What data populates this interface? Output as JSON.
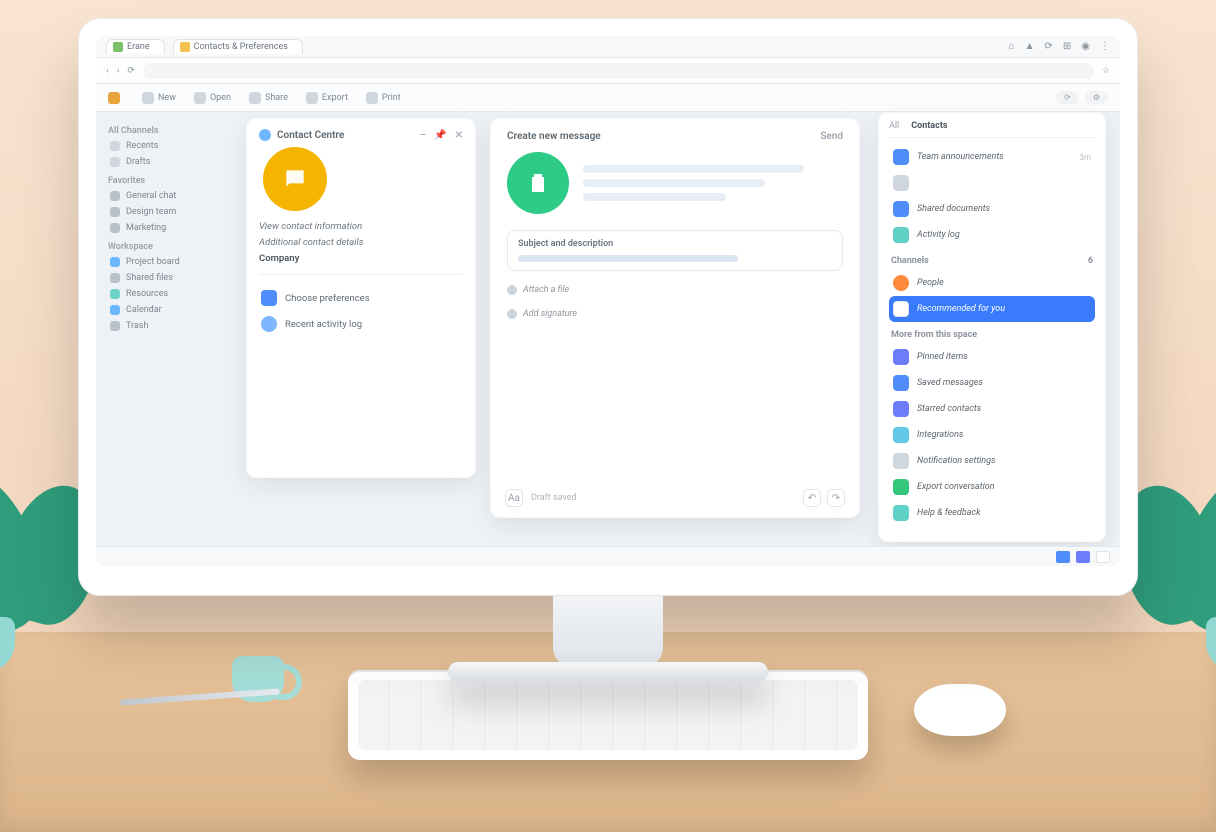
{
  "browser": {
    "tab1": {
      "favicon": "#7bbf6b",
      "label": "Erane"
    },
    "tab2": {
      "favicon": "#f2c14e",
      "label": "Contacts & Preferences"
    },
    "actions": [
      "home",
      "bell",
      "sync",
      "ext",
      "user",
      "menu"
    ],
    "url": "",
    "nav_icons": [
      "back",
      "forward",
      "reload"
    ]
  },
  "toolbar": {
    "items": [
      {
        "icon": "#e8a33b",
        "label": ""
      },
      {
        "icon": "#cfd6dd",
        "label": "New"
      },
      {
        "icon": "#cfd6dd",
        "label": "Open"
      },
      {
        "icon": "#cfd6dd",
        "label": "Share"
      },
      {
        "icon": "#cfd6dd",
        "label": "Export"
      },
      {
        "icon": "#cfd6dd",
        "label": "Print"
      }
    ],
    "right": [
      "refresh",
      "settings"
    ]
  },
  "leftnav": {
    "sections": [
      {
        "title": "All Channels",
        "items": [
          {
            "color": "#cfd6dd",
            "label": "Recents"
          },
          {
            "color": "#cfd6dd",
            "label": "Drafts"
          }
        ]
      },
      {
        "title": "Favorites",
        "items": [
          {
            "color": "#b9c2cb",
            "label": "General chat"
          },
          {
            "color": "#b9c2cb",
            "label": "Design team"
          },
          {
            "color": "#b9c2cb",
            "label": "Marketing"
          }
        ]
      },
      {
        "title": "Workspace",
        "items": [
          {
            "color": "#6fb7ff",
            "label": "Project board"
          },
          {
            "color": "#b9c2cb",
            "label": "Shared files"
          },
          {
            "color": "#6ed3c7",
            "label": "Resources"
          },
          {
            "color": "#6fb7ff",
            "label": "Calendar"
          }
        ]
      },
      {
        "title": "",
        "items": [
          {
            "color": "#b9c2cb",
            "label": "Trash"
          }
        ]
      }
    ]
  },
  "card_left": {
    "title": "Contact Centre",
    "actions": [
      "minimize",
      "pin",
      "close"
    ],
    "avatar_icon": "chat-bubble",
    "rows": [
      "View contact information",
      "Additional contact details",
      "Company"
    ],
    "links": [
      {
        "color": "blue",
        "label": "Choose preferences"
      },
      {
        "color": "lblue",
        "label": "Recent activity log"
      }
    ]
  },
  "card_center": {
    "title": "Create new message",
    "action": "Send",
    "hero_icon": "clipboard",
    "input_label": "Subject and description",
    "meta1": "Attach a file",
    "meta2": "Add signature",
    "footer_left": "Draft saved",
    "footer_hint": "Aa",
    "footer_icons": [
      "undo",
      "redo"
    ]
  },
  "card_right": {
    "tabs": [
      "All",
      "Contacts"
    ],
    "section1": {
      "items": [
        {
          "icon": "c-blue",
          "label": "Team announcements",
          "meta": "3m"
        },
        {
          "icon": "c-gray",
          "label": "",
          "meta": ""
        },
        {
          "icon": "c-blue",
          "label": "Shared documents",
          "meta": ""
        },
        {
          "icon": "c-teal",
          "label": "Activity log",
          "meta": ""
        }
      ]
    },
    "section2": {
      "title": "Channels",
      "meta": "6",
      "items": [
        {
          "icon": "c-orange round",
          "label": "People",
          "meta": ""
        },
        {
          "icon": "c-white",
          "label": "Recommended for you",
          "highlight": true
        }
      ]
    },
    "section3": {
      "title": "More from this space",
      "items": [
        {
          "icon": "c-indigo",
          "label": "Pinned items"
        },
        {
          "icon": "c-blue",
          "label": "Saved messages"
        },
        {
          "icon": "c-indigo",
          "label": "Starred contacts"
        },
        {
          "icon": "c-cyan",
          "label": "Integrations"
        },
        {
          "icon": "c-gray",
          "label": "Notification settings"
        },
        {
          "icon": "c-green",
          "label": "Export conversation"
        },
        {
          "icon": "c-teal",
          "label": "Help & feedback"
        }
      ]
    }
  },
  "taskbar": {
    "items": [
      "#4f8dfb",
      "#6d7cfb",
      "#ffffff"
    ]
  }
}
